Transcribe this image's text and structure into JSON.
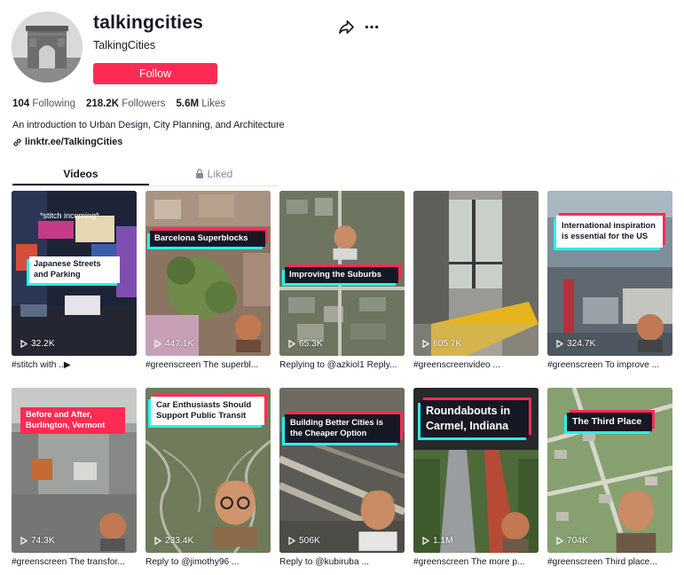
{
  "profile": {
    "username": "talkingcities",
    "nickname": "TalkingCities",
    "follow_label": "Follow",
    "avatar_icon": "arc-de-triomphe-avatar",
    "stats": [
      {
        "value": "104",
        "label": "Following"
      },
      {
        "value": "218.2K",
        "label": "Followers"
      },
      {
        "value": "5.6M",
        "label": "Likes"
      }
    ],
    "bio": "An introduction to Urban Design, City Planning, and Architecture",
    "link": "linktr.ee/TalkingCities"
  },
  "actions": {
    "share_icon": "share-icon",
    "more_icon": "more-icon"
  },
  "tabs": [
    {
      "label": "Videos",
      "active": true
    },
    {
      "label": "Liked",
      "active": false,
      "icon": "lock-icon"
    }
  ],
  "videos": [
    {
      "overlay": "Japanese Streets and Parking",
      "top_text": "*stitch incoming*",
      "views": "32.2K",
      "description": "#stitch with ..▶"
    },
    {
      "overlay": "Barcelona Superblocks",
      "views": "447.1K",
      "description": "#greenscreen The superbl..."
    },
    {
      "overlay": "Improving the Suburbs",
      "views": "65.3K",
      "description": "Replying to @azkiol1 Reply..."
    },
    {
      "overlay": "",
      "views": "605.7K",
      "description": "#greenscreenvideo ..."
    },
    {
      "overlay": "International inspiration is essential for the US",
      "views": "324.7K",
      "description": "#greenscreen To improve ..."
    },
    {
      "overlay": "Before and After, Burlington, Vermont",
      "views": "74.3K",
      "description": "#greenscreen The transfor..."
    },
    {
      "overlay": "Car Enthusiasts Should Support Public Transit",
      "views": "233.4K",
      "description": "Reply to @jimothy96 ..."
    },
    {
      "overlay": "Building Better Cities is the Cheaper Option",
      "views": "506K",
      "description": "Reply to @kubiruba ..."
    },
    {
      "overlay": "Roundabouts in Carmel, Indiana",
      "views": "1.1M",
      "description": "#greenscreen The more p..."
    },
    {
      "overlay": "The Third Place",
      "views": "704K",
      "description": "#greenscreen Third place..."
    }
  ],
  "colors": {
    "accent": "#fe2c55",
    "text": "#161823",
    "cyan": "#25f4ee"
  }
}
